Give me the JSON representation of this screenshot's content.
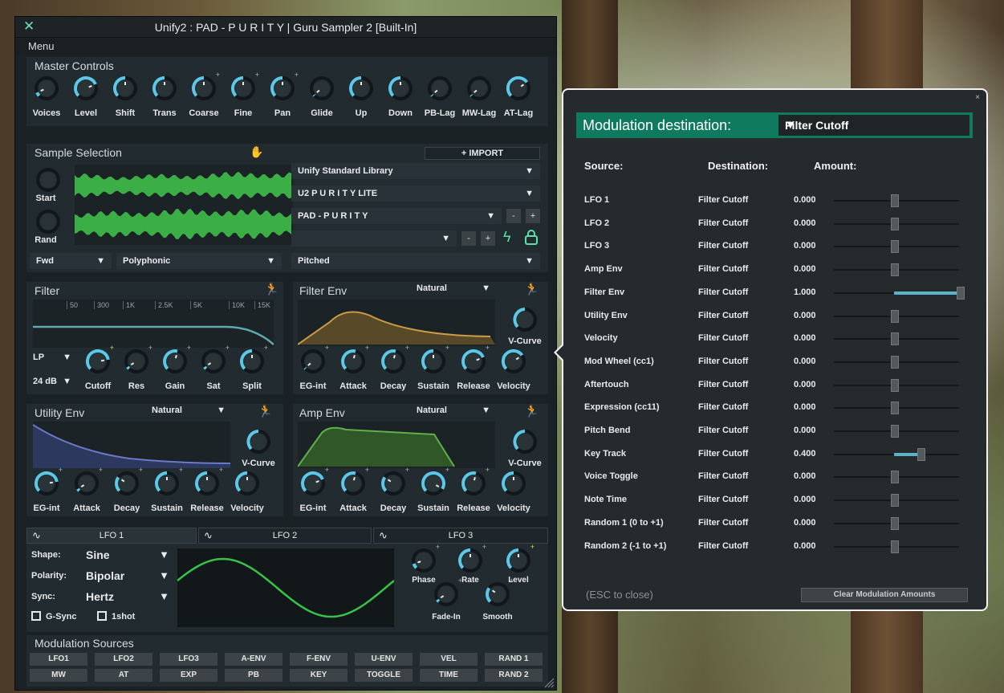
{
  "window": {
    "title": "Unify2 : PAD - P U R I T Y | Guru Sampler 2 [Built-In]",
    "menu": "Menu"
  },
  "master": {
    "title": "Master Controls",
    "knobs": [
      "Voices",
      "Level",
      "Shift",
      "Trans",
      "Coarse",
      "Fine",
      "Pan",
      "Glide",
      "Up",
      "Down",
      "PB-Lag",
      "MW-Lag",
      "AT-Lag"
    ]
  },
  "sample": {
    "title": "Sample Selection",
    "import": "+ IMPORT",
    "start": "Start",
    "rand": "Rand",
    "direction": "Fwd",
    "voice_mode": "Polyphonic",
    "library": "Unify Standard Library",
    "bank": "U2 P U R I T Y LITE",
    "patch": "PAD - P U R I T Y",
    "pitch_mode": "Pitched"
  },
  "filter": {
    "title": "Filter",
    "freq_labels": [
      "50",
      "300",
      "1K",
      "2.5K",
      "5K",
      "10K",
      "15K"
    ],
    "type": "LP",
    "slope": "24 dB",
    "knobs": [
      "Cutoff",
      "Res",
      "Gain",
      "Sat",
      "Split"
    ]
  },
  "filter_env": {
    "title": "Filter Env",
    "mode": "Natural",
    "curve": "V-Curve",
    "knobs": [
      "EG-int",
      "Attack",
      "Decay",
      "Sustain",
      "Release",
      "Velocity"
    ]
  },
  "utility_env": {
    "title": "Utility Env",
    "mode": "Natural",
    "curve": "V-Curve",
    "knobs": [
      "EG-int",
      "Attack",
      "Decay",
      "Sustain",
      "Release",
      "Velocity"
    ]
  },
  "amp_env": {
    "title": "Amp Env",
    "mode": "Natural",
    "curve": "V-Curve",
    "knobs": [
      "EG-int",
      "Attack",
      "Decay",
      "Sustain",
      "Release",
      "Velocity"
    ]
  },
  "lfo": {
    "tabs": [
      "LFO 1",
      "LFO 2",
      "LFO 3"
    ],
    "shape_label": "Shape:",
    "shape": "Sine",
    "polarity_label": "Polarity:",
    "polarity": "Bipolar",
    "sync_label": "Sync:",
    "sync": "Hertz",
    "gsync": "G-Sync",
    "oneshot": "1shot",
    "knobs": [
      "Phase",
      "Rate",
      "Level",
      "Fade-In",
      "Smooth"
    ]
  },
  "mod_sources": {
    "title": "Modulation Sources",
    "row1": [
      "LFO1",
      "LFO2",
      "LFO3",
      "A-ENV",
      "F-ENV",
      "U-ENV",
      "VEL",
      "RAND 1"
    ],
    "row2": [
      "MW",
      "AT",
      "EXP",
      "PB",
      "KEY",
      "TOGGLE",
      "TIME",
      "RAND 2"
    ]
  },
  "modulation": {
    "header": "Modulation destination:",
    "destination": "Filter Cutoff",
    "col_source": "Source:",
    "col_destination": "Destination:",
    "col_amount": "Amount:",
    "rows": [
      {
        "source": "LFO 1",
        "destination": "Filter Cutoff",
        "amount": "0.000",
        "value": 0.0
      },
      {
        "source": "LFO 2",
        "destination": "Filter Cutoff",
        "amount": "0.000",
        "value": 0.0
      },
      {
        "source": "LFO 3",
        "destination": "Filter Cutoff",
        "amount": "0.000",
        "value": 0.0
      },
      {
        "source": "Amp Env",
        "destination": "Filter Cutoff",
        "amount": "0.000",
        "value": 0.0
      },
      {
        "source": "Filter Env",
        "destination": "Filter Cutoff",
        "amount": "1.000",
        "value": 1.0
      },
      {
        "source": "Utility Env",
        "destination": "Filter Cutoff",
        "amount": "0.000",
        "value": 0.0
      },
      {
        "source": "Velocity",
        "destination": "Filter Cutoff",
        "amount": "0.000",
        "value": 0.0
      },
      {
        "source": "Mod Wheel (cc1)",
        "destination": "Filter Cutoff",
        "amount": "0.000",
        "value": 0.0
      },
      {
        "source": "Aftertouch",
        "destination": "Filter Cutoff",
        "amount": "0.000",
        "value": 0.0
      },
      {
        "source": "Expression (cc11)",
        "destination": "Filter Cutoff",
        "amount": "0.000",
        "value": 0.0
      },
      {
        "source": "Pitch Bend",
        "destination": "Filter Cutoff",
        "amount": "0.000",
        "value": 0.0
      },
      {
        "source": "Key Track",
        "destination": "Filter Cutoff",
        "amount": "0.400",
        "value": 0.4
      },
      {
        "source": "Voice Toggle",
        "destination": "Filter Cutoff",
        "amount": "0.000",
        "value": 0.0
      },
      {
        "source": "Note Time",
        "destination": "Filter Cutoff",
        "amount": "0.000",
        "value": 0.0
      },
      {
        "source": "Random 1 (0 to +1)",
        "destination": "Filter Cutoff",
        "amount": "0.000",
        "value": 0.0
      },
      {
        "source": "Random 2 (-1 to +1)",
        "destination": "Filter Cutoff",
        "amount": "0.000",
        "value": 0.0
      }
    ],
    "esc_hint": "(ESC to close)",
    "clear": "Clear Modulation Amounts"
  },
  "colors": {
    "accent": "#5bc8e8",
    "header_green": "#0f7a5d",
    "waveform_green": "#3fbf4a",
    "filter_env": "#b88a3a",
    "utility_env": "#5a6aa8",
    "amp_env": "#4f9a3a"
  }
}
